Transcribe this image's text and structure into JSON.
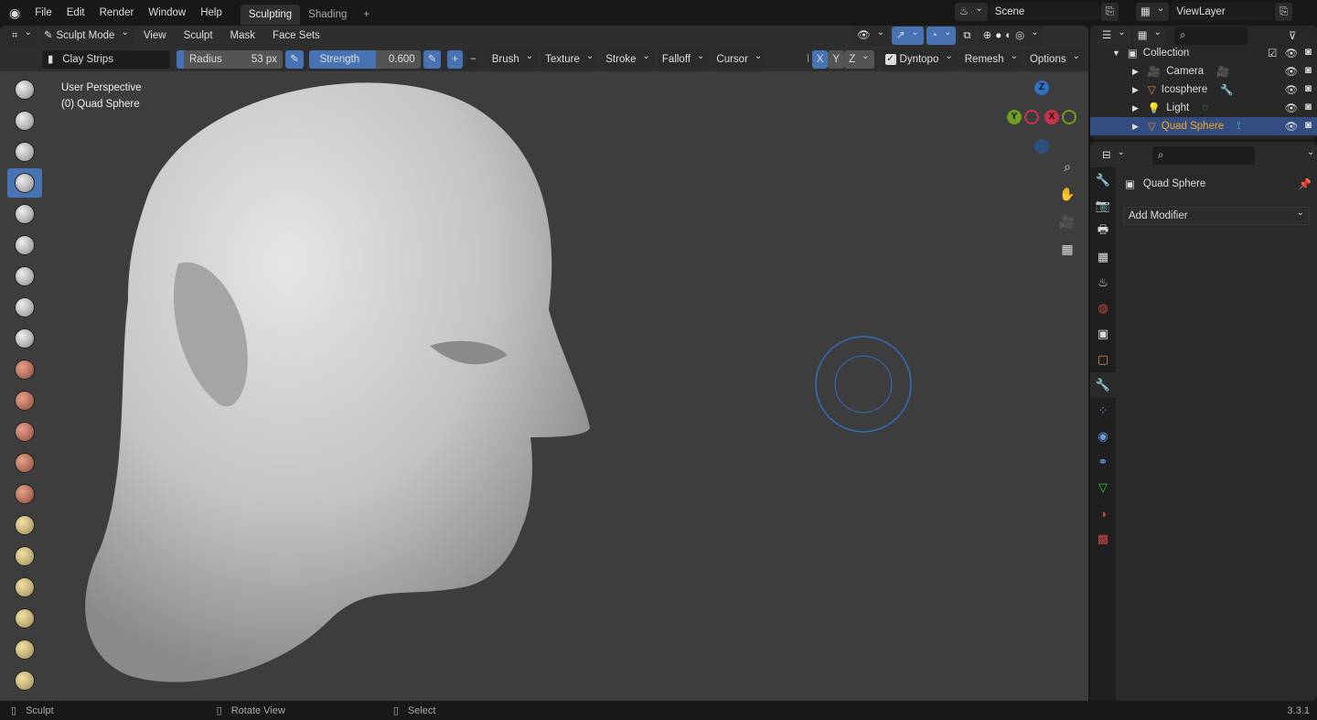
{
  "topbar": {
    "menus": [
      "File",
      "Edit",
      "Render",
      "Window",
      "Help"
    ],
    "workspaces": [
      "Sculpting",
      "Shading"
    ],
    "add_tab": "+",
    "scene": "Scene",
    "view_layer": "ViewLayer"
  },
  "viewport_header": {
    "mode": "Sculpt Mode",
    "menus": [
      "View",
      "Sculpt",
      "Mask",
      "Face Sets"
    ]
  },
  "tool_settings": {
    "brush_name": "Clay Strips",
    "radius_label": "Radius",
    "radius_value": "53 px",
    "strength_label": "Strength",
    "strength_value": "0.600",
    "strength_fraction": 0.6,
    "plus": "+",
    "minus": "−",
    "dropdowns": [
      "Brush",
      "Texture",
      "Stroke",
      "Falloff",
      "Cursor"
    ],
    "symmetry": [
      "X",
      "Y",
      "Z"
    ],
    "dyntopo": "Dyntopo",
    "dyntopo_checked": true,
    "remesh": "Remesh",
    "options": "Options"
  },
  "viewport": {
    "perspective": "User Perspective",
    "object_info": "(0) Quad Sphere",
    "gizmo": {
      "z": "Z",
      "y": "Y",
      "x": "X"
    },
    "accent": "#4772b3"
  },
  "toolbar": {
    "tools": [
      "draw",
      "draw-sharp",
      "clay",
      "clay-strips",
      "clay-thumb",
      "layer",
      "inflate",
      "blob",
      "crease",
      "smooth",
      "flatten",
      "fill",
      "scrape",
      "multiplane-scrape",
      "pinch",
      "grab",
      "elastic-deform",
      "snake-hook",
      "thumb",
      "pose"
    ],
    "active_index": 3
  },
  "outliner": {
    "collection": "Collection",
    "items": [
      {
        "name": "Camera",
        "icon": "camera-icon"
      },
      {
        "name": "Icosphere",
        "icon": "mesh-icon"
      },
      {
        "name": "Light",
        "icon": "light-icon"
      },
      {
        "name": "Quad Sphere",
        "icon": "mesh-icon",
        "selected": true
      }
    ]
  },
  "properties": {
    "object_name": "Quad Sphere",
    "add_modifier": "Add Modifier"
  },
  "status": {
    "items": [
      "Sculpt",
      "Rotate View",
      "Select"
    ],
    "version": "3.3.1"
  }
}
